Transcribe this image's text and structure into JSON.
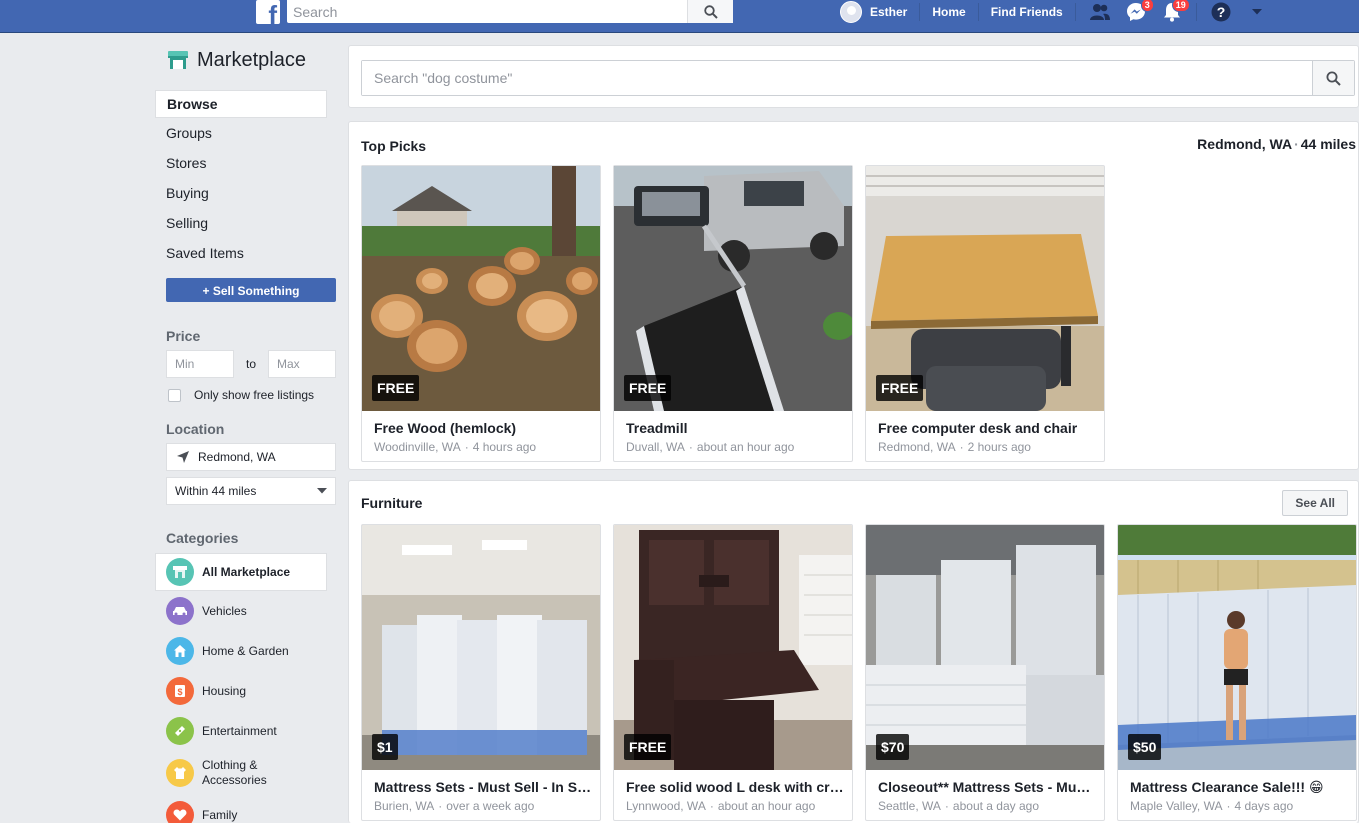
{
  "topbar": {
    "search_placeholder": "Search",
    "user_name": "Esther",
    "home_label": "Home",
    "find_friends_label": "Find Friends",
    "messages_count": "3",
    "notifications_count": "19"
  },
  "sidebar": {
    "title": "Marketplace",
    "nav": [
      {
        "label": "Browse"
      },
      {
        "label": "Groups"
      },
      {
        "label": "Stores"
      },
      {
        "label": "Buying"
      },
      {
        "label": "Selling"
      },
      {
        "label": "Saved Items"
      }
    ],
    "sell_button": "+ Sell Something",
    "price_heading": "Price",
    "min_placeholder": "Min",
    "to_label": "to",
    "max_placeholder": "Max",
    "free_only_label": "Only show free listings",
    "location_heading": "Location",
    "location_value": "Redmond, WA",
    "radius_value": "Within 44 miles",
    "categories_heading": "Categories",
    "categories": [
      {
        "label": "All Marketplace",
        "color": "#57c4b4",
        "icon": "storefront-icon"
      },
      {
        "label": "Vehicles",
        "color": "#8c72cb",
        "icon": "car-icon"
      },
      {
        "label": "Home & Garden",
        "color": "#4cb7e8",
        "icon": "house-icon"
      },
      {
        "label": "Housing",
        "color": "#f3693b",
        "icon": "housing-icon"
      },
      {
        "label": "Entertainment",
        "color": "#8bc34a",
        "icon": "ticket-icon"
      },
      {
        "label": "Clothing & Accessories",
        "color": "#f7c948",
        "icon": "shirt-icon"
      },
      {
        "label": "Family",
        "color": "#f35b3a",
        "icon": "heart-icon"
      }
    ]
  },
  "main": {
    "search_placeholder": "Search \"dog costume\"",
    "top_picks": {
      "title": "Top Picks",
      "location": "Redmond, WA",
      "distance": "44 miles",
      "items": [
        {
          "price": "FREE",
          "title": "Free Wood (hemlock)",
          "place": "Woodinville, WA",
          "time": "4 hours ago"
        },
        {
          "price": "FREE",
          "title": "Treadmill",
          "place": "Duvall, WA",
          "time": "about an hour ago"
        },
        {
          "price": "FREE",
          "title": "Free computer desk and chair",
          "place": "Redmond, WA",
          "time": "2 hours ago"
        }
      ]
    },
    "furniture": {
      "title": "Furniture",
      "see_all": "See All",
      "items": [
        {
          "price": "$1",
          "title": "Mattress Sets - Must Sell - In Sto...",
          "place": "Burien, WA",
          "time": "over a week ago"
        },
        {
          "price": "FREE",
          "title": "Free solid wood L desk with cre...",
          "place": "Lynnwood, WA",
          "time": "about an hour ago"
        },
        {
          "price": "$70",
          "title": "Closeout** Mattress Sets - Must ...",
          "place": "Seattle, WA",
          "time": "about a day ago"
        },
        {
          "price": "$50",
          "title": "Mattress Clearance Sale!!! 😁",
          "place": "Maple Valley, WA",
          "time": "4 days ago"
        }
      ]
    }
  }
}
